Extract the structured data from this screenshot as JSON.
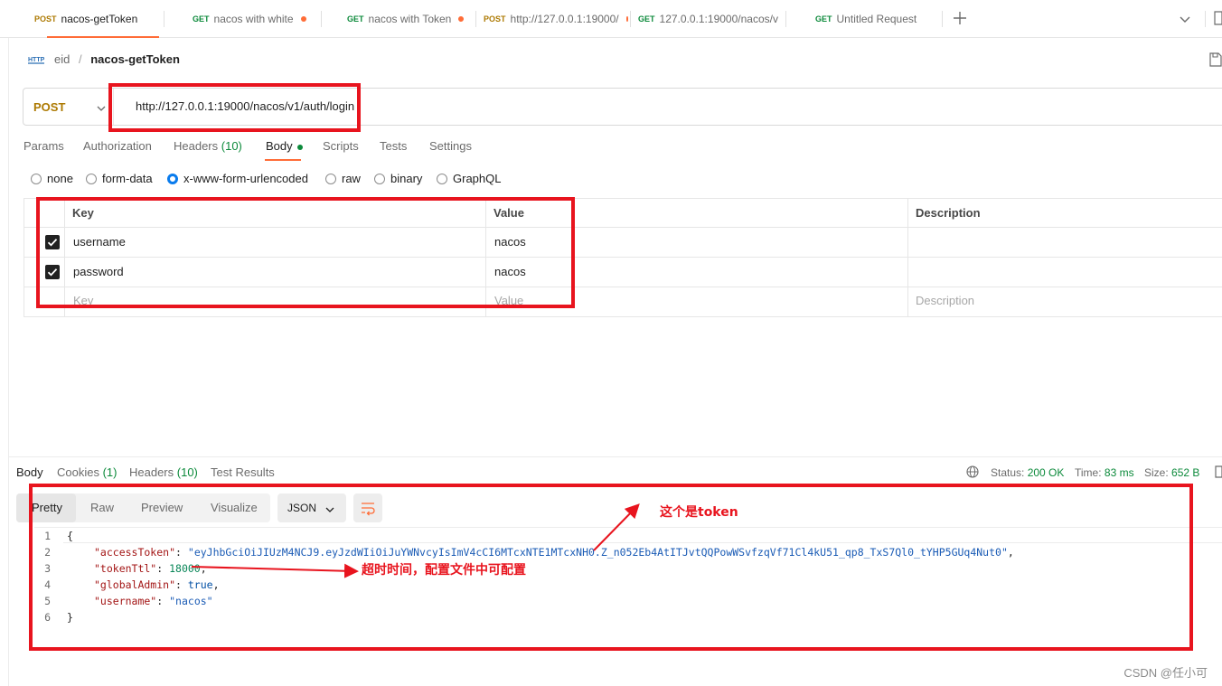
{
  "tabs": [
    {
      "method": "POST",
      "label": "nacos-getToken",
      "modified": false
    },
    {
      "method": "GET",
      "label": "nacos with white",
      "modified": true
    },
    {
      "method": "GET",
      "label": "nacos with Token",
      "modified": true
    },
    {
      "method": "POST",
      "label": "http://127.0.0.1:19000/",
      "modified": true
    },
    {
      "method": "GET",
      "label": "127.0.0.1:19000/nacos/v",
      "modified": true
    },
    {
      "method": "GET",
      "label": "Untitled Request",
      "modified": false
    }
  ],
  "breadcrumb": {
    "collection": "eid",
    "separator": "/",
    "request": "nacos-getToken",
    "http_icon_text": "HTTP"
  },
  "request": {
    "method": "POST",
    "url": "http://127.0.0.1:19000/nacos/v1/auth/login"
  },
  "request_tabs": {
    "params": "Params",
    "authorization": "Authorization",
    "headers": "Headers",
    "headers_count": "(10)",
    "body": "Body",
    "scripts": "Scripts",
    "tests": "Tests",
    "settings": "Settings"
  },
  "body_types": [
    "none",
    "form-data",
    "x-www-form-urlencoded",
    "raw",
    "binary",
    "GraphQL"
  ],
  "selected_body_type": "x-www-form-urlencoded",
  "params_table": {
    "headers": {
      "key": "Key",
      "value": "Value",
      "description": "Description"
    },
    "rows": [
      {
        "checked": true,
        "key": "username",
        "value": "nacos",
        "description": ""
      },
      {
        "checked": true,
        "key": "password",
        "value": "nacos",
        "description": ""
      }
    ],
    "placeholder": {
      "key": "Key",
      "value": "Value",
      "description": "Description"
    }
  },
  "response_tabs": {
    "body": "Body",
    "cookies": "Cookies",
    "cookies_count": "(1)",
    "headers": "Headers",
    "headers_count": "(10)",
    "test_results": "Test Results"
  },
  "response_meta": {
    "status_label": "Status:",
    "status_value": "200 OK",
    "time_label": "Time:",
    "time_value": "83 ms",
    "size_label": "Size:",
    "size_value": "652 B"
  },
  "view_modes": [
    "Pretty",
    "Raw",
    "Preview",
    "Visualize"
  ],
  "format": "JSON",
  "response_json": {
    "accessToken": "eyJhbGciOiJIUzM4NCJ9.eyJzdWIiOiJuYWNvcyIsImV4cCI6MTcxNTE1MTcxNH0.Z_n052Eb4AtITJvtQQPowWSvfzqVf71Cl4kU51_qp8_TxS7Ql0_tYHP5GUq4Nut0",
    "tokenTtl": "18000",
    "globalAdmin": "true",
    "username": "nacos"
  },
  "line_numbers": [
    "1",
    "2",
    "3",
    "4",
    "5",
    "6"
  ],
  "annotations": {
    "token": "这个是token",
    "ttl": "超时时间，配置文件中可配置"
  },
  "colors": {
    "accent": "#ff6c37",
    "annotation_red": "#e8141e",
    "post": "#ad7a03",
    "get": "#0c8a3b"
  },
  "watermark": "CSDN @任小可"
}
